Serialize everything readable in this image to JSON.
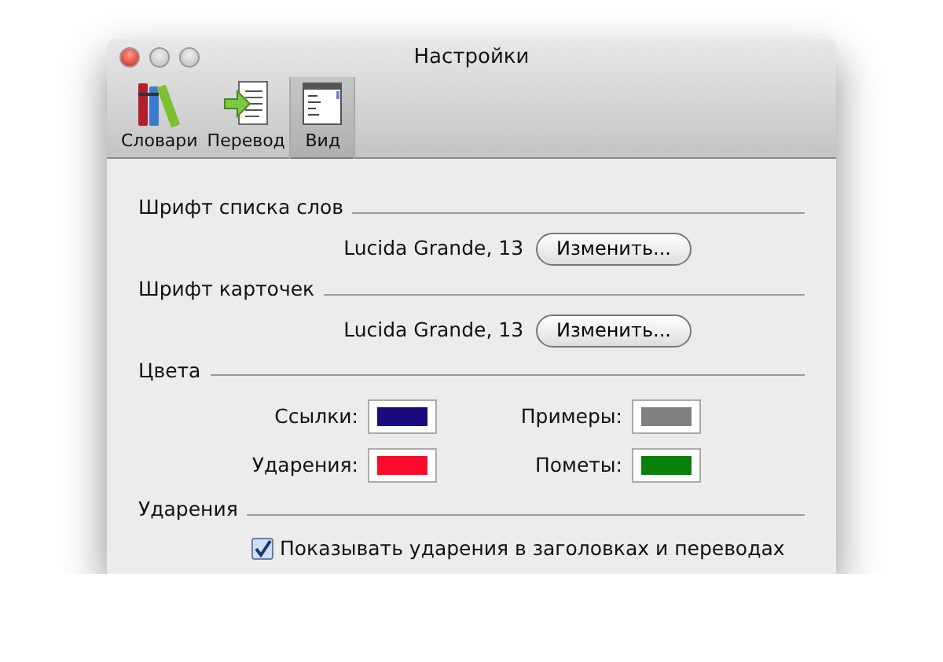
{
  "window": {
    "title": "Настройки"
  },
  "toolbar": [
    {
      "label": "Словари",
      "kind": "books",
      "selected": false
    },
    {
      "label": "Перевод",
      "kind": "translate",
      "selected": false
    },
    {
      "label": "Вид",
      "kind": "view",
      "selected": true
    }
  ],
  "sections": [
    {
      "kind": "font",
      "title": "Шрифт списка слов",
      "value": "Lucida Grande, 13",
      "button": "Изменить..."
    },
    {
      "kind": "font",
      "title": "Шрифт карточек",
      "value": "Lucida Grande, 13",
      "button": "Изменить..."
    },
    {
      "kind": "colors",
      "title": "Цвета",
      "swatches": [
        {
          "label": "Ссылки:",
          "color": "#1a0a80"
        },
        {
          "label": "Примеры:",
          "color": "#808080"
        },
        {
          "label": "Ударения:",
          "color": "#ff0a2a"
        },
        {
          "label": "Пометы:",
          "color": "#0a800a"
        }
      ]
    },
    {
      "kind": "checkbox",
      "title": "Ударения",
      "label": "Показывать ударения в заголовках и переводах",
      "checked": true
    }
  ]
}
